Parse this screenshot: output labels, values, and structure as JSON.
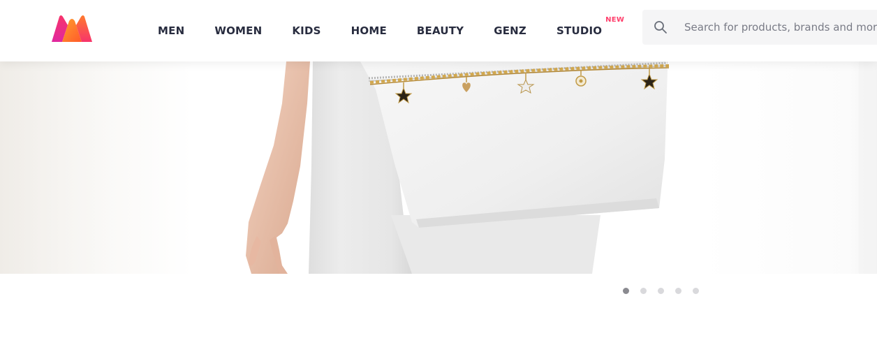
{
  "brand": {
    "logo_icon": "myntra-m-logo-icon"
  },
  "nav": {
    "items": [
      {
        "label": "MEN"
      },
      {
        "label": "WOMEN"
      },
      {
        "label": "KIDS"
      },
      {
        "label": "HOME"
      },
      {
        "label": "BEAUTY"
      },
      {
        "label": "GENZ"
      },
      {
        "label": "STUDIO",
        "badge": "NEW"
      }
    ]
  },
  "search": {
    "icon": "search-icon",
    "placeholder": "Search for products, brands and more",
    "value": ""
  },
  "banner": {
    "image": "white-handbag-with-charm-chain-banner",
    "slides_total": 5,
    "active_slide": 1
  },
  "colors": {
    "text": "#282c3f",
    "accent": "#ff3f6c",
    "search_bg": "#f5f5f6",
    "dot_active": "#8a8a90",
    "dot_inactive": "#d9d9dc"
  }
}
